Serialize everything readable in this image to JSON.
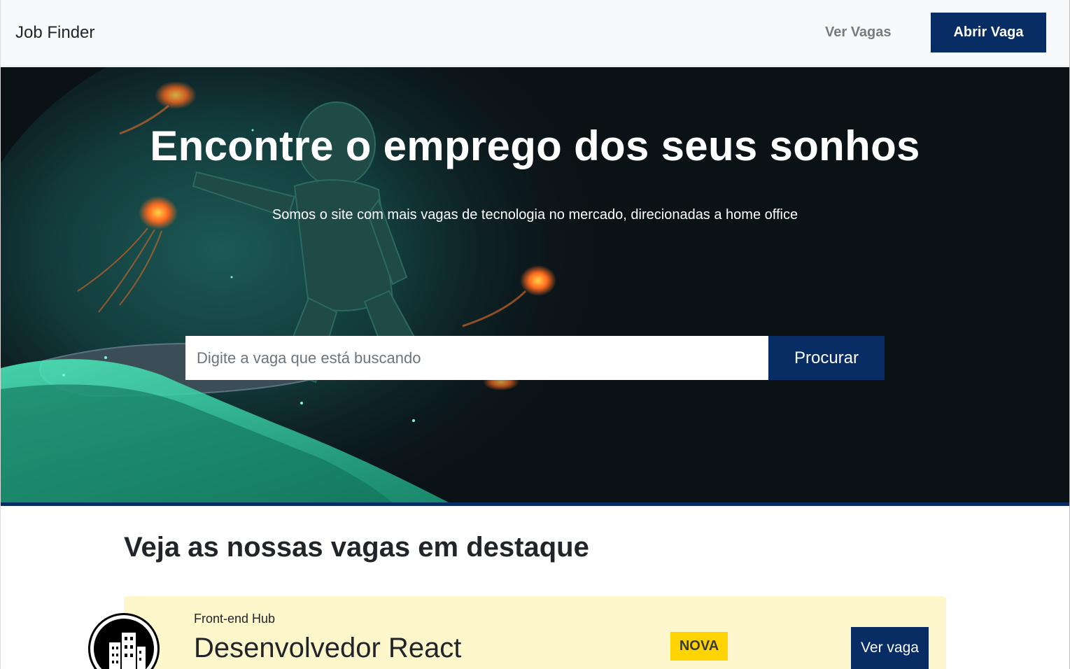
{
  "navbar": {
    "brand": "Job Finder",
    "link_label": "Ver Vagas",
    "cta_label": "Abrir Vaga"
  },
  "hero": {
    "title": "Encontre o emprego dos seus sonhos",
    "subtitle": "Somos o site com mais vagas de tecnologia no mercado, direcionadas a home office",
    "search": {
      "placeholder": "Digite a vaga que está buscando",
      "button_label": "Procurar"
    }
  },
  "featured": {
    "heading": "Veja as nossas vagas em destaque",
    "jobs": [
      {
        "company": "Front-end Hub",
        "title": "Desenvolvedor React",
        "badge": "NOVA",
        "button_label": "Ver vaga",
        "logo_icon": "building-icon"
      }
    ]
  },
  "colors": {
    "primary": "#082c64",
    "badge": "#ffd400",
    "card_bg": "#fff7cc",
    "hero_bg": "#0b1216",
    "accent_green": "#2fd9a4"
  }
}
